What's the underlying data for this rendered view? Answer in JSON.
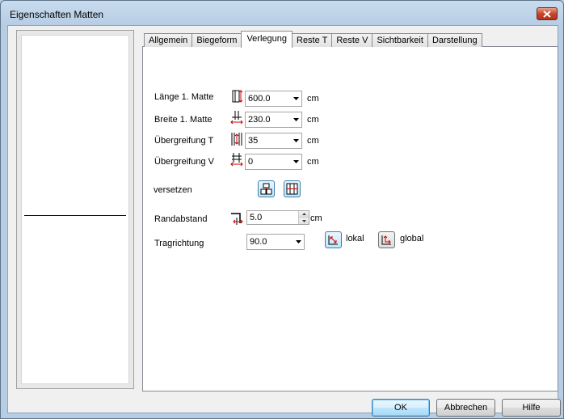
{
  "window": {
    "title": "Eigenschaften Matten"
  },
  "tabs": [
    {
      "label": "Allgemein",
      "active": false
    },
    {
      "label": "Biegeform",
      "active": false
    },
    {
      "label": "Verlegung",
      "active": true
    },
    {
      "label": "Reste T",
      "active": false
    },
    {
      "label": "Reste V",
      "active": false
    },
    {
      "label": "Sichtbarkeit",
      "active": false
    },
    {
      "label": "Darstellung",
      "active": false
    }
  ],
  "form": {
    "laenge": {
      "label": "Länge 1. Matte",
      "value": "600.0",
      "unit": "cm",
      "icon": "mat-length-icon"
    },
    "breite": {
      "label": "Breite 1. Matte",
      "value": "230.0",
      "unit": "cm",
      "icon": "mat-width-icon"
    },
    "uebergreifung_t": {
      "label": "Übergreifung T",
      "value": "35",
      "unit": "cm",
      "icon": "overlap-t-icon"
    },
    "uebergreifung_v": {
      "label": "Übergreifung V",
      "value": "0",
      "unit": "cm",
      "icon": "overlap-v-icon"
    },
    "versetzen": {
      "label": "versetzen",
      "buttons": [
        "staggered-layout-icon",
        "grid-layout-icon"
      ]
    },
    "randabstand": {
      "label": "Randabstand",
      "value": "5.0",
      "unit": "cm",
      "icon": "edge-distance-icon"
    },
    "tragrichtung": {
      "label": "Tragrichtung",
      "value": "90.0",
      "lokal_label": "lokal",
      "global_label": "global"
    }
  },
  "footer": {
    "ok": "OK",
    "cancel": "Abbrechen",
    "help": "Hilfe"
  },
  "colors": {
    "accent_border": "#3c7fb1",
    "close_red": "#c7452c",
    "titlebar": "#c9dcef"
  }
}
